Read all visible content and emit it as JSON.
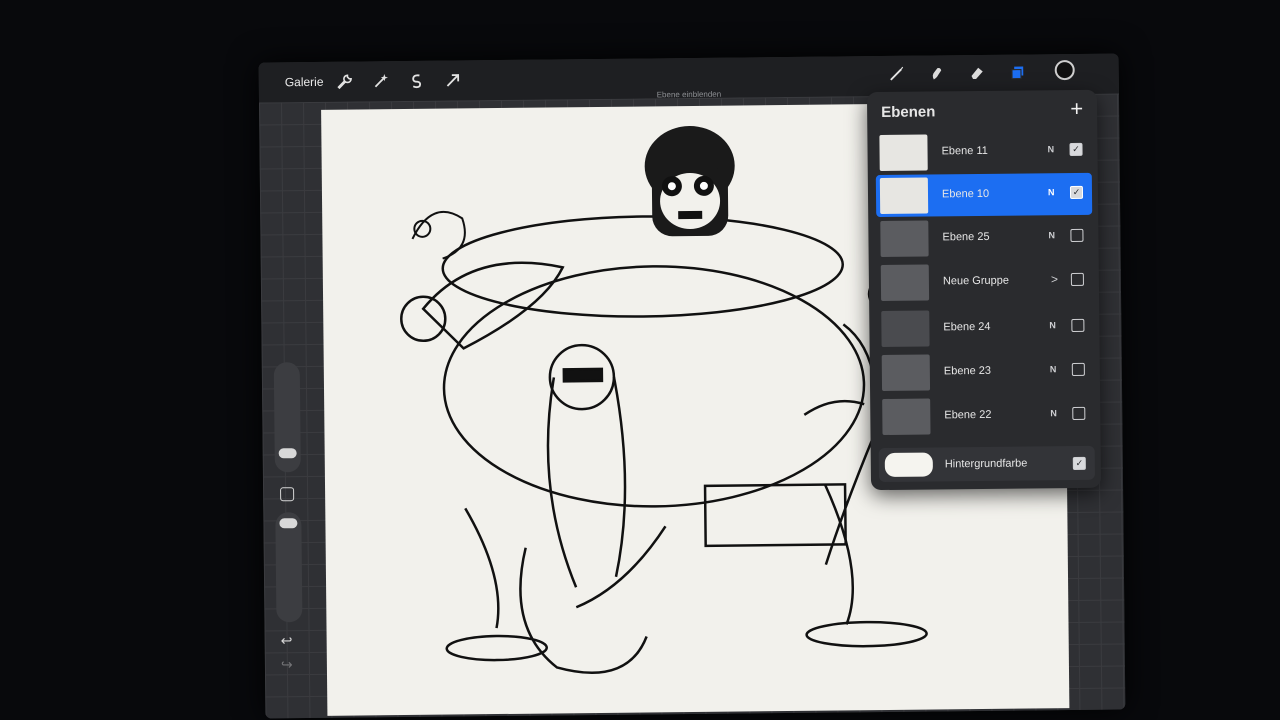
{
  "toolbar": {
    "gallery_label": "Galerie",
    "hint_text": "Ebene einblenden",
    "tools_left": [
      "wrench-icon",
      "magic-wand-icon",
      "selection-icon",
      "transform-arrow-icon"
    ],
    "tools_right": [
      "brush-icon",
      "smudge-icon",
      "eraser-icon",
      "layers-icon"
    ],
    "current_color": "#101010",
    "accent": "#1c6ef2"
  },
  "sidebar": {
    "undo_icon": "undo-icon",
    "redo_icon": "redo-icon"
  },
  "layers_panel": {
    "title": "Ebenen",
    "add_label": "+",
    "layers": [
      {
        "name": "Ebene 11",
        "mode": "N",
        "visible": true,
        "active": false
      },
      {
        "name": "Ebene 10",
        "mode": "N",
        "visible": true,
        "active": true
      },
      {
        "name": "Ebene 25",
        "mode": "N",
        "visible": false,
        "active": false
      },
      {
        "name": "Neue Gruppe",
        "mode": ">",
        "visible": false,
        "active": false,
        "group": true
      },
      {
        "name": "Ebene 24",
        "mode": "N",
        "visible": false,
        "active": false
      },
      {
        "name": "Ebene 23",
        "mode": "N",
        "visible": false,
        "active": false
      },
      {
        "name": "Ebene 22",
        "mode": "N",
        "visible": false,
        "active": false
      }
    ],
    "background": {
      "name": "Hintergrundfarbe",
      "visible": true
    }
  }
}
